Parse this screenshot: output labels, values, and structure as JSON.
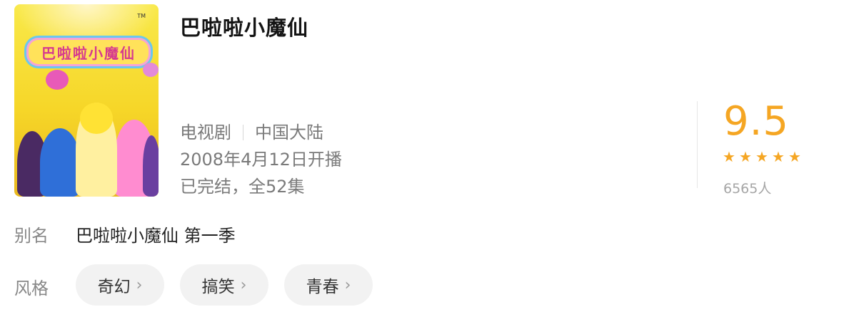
{
  "show": {
    "title": "巴啦啦小魔仙",
    "poster_logo_text": "巴啦啦小魔仙",
    "type": "电视剧",
    "region": "中国大陆",
    "premiere": "2008年4月12日开播",
    "status": "已完结，全52集"
  },
  "rating": {
    "score": "9.5",
    "stars": [
      "★",
      "★",
      "★",
      "★",
      "★"
    ],
    "star_fill_fraction": 1.0,
    "count": "6565人",
    "accent_color": "#f5a623"
  },
  "alias": {
    "label": "别名",
    "value": "巴啦啦小魔仙 第一季"
  },
  "styles": {
    "label": "风格",
    "tags": [
      {
        "label": "奇幻",
        "chevron": "›"
      },
      {
        "label": "搞笑",
        "chevron": "›"
      },
      {
        "label": "青春",
        "chevron": "›"
      }
    ]
  }
}
